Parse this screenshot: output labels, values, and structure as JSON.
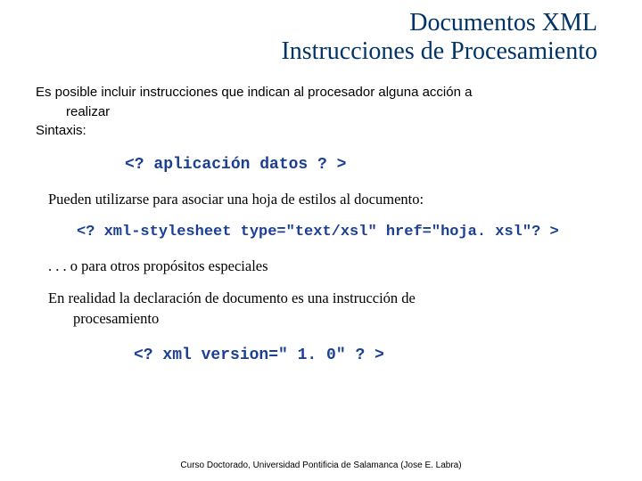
{
  "title": {
    "line1": "Documentos XML",
    "line2": "Instrucciones de Procesamiento"
  },
  "para1_line1": "Es posible incluir instrucciones que indican al procesador alguna acción a",
  "para1_line2": "realizar",
  "para2": "Sintaxis:",
  "code1": "<? aplicación datos ? >",
  "serif1": "Pueden utilizarse para asociar una hoja de estilos al documento:",
  "code2": "<? xml-stylesheet type=\"text/xsl\" href=\"hoja. xsl\"? >",
  "serif2": ". . . o para otros propósitos especiales",
  "serif3a": "En realidad la declaración de documento es una instrucción de",
  "serif3b": "procesamiento",
  "code3": "<? xml version=\" 1. 0\" ? >",
  "footer": "Curso Doctorado, Universidad Pontificia de Salamanca (Jose E. Labra)"
}
